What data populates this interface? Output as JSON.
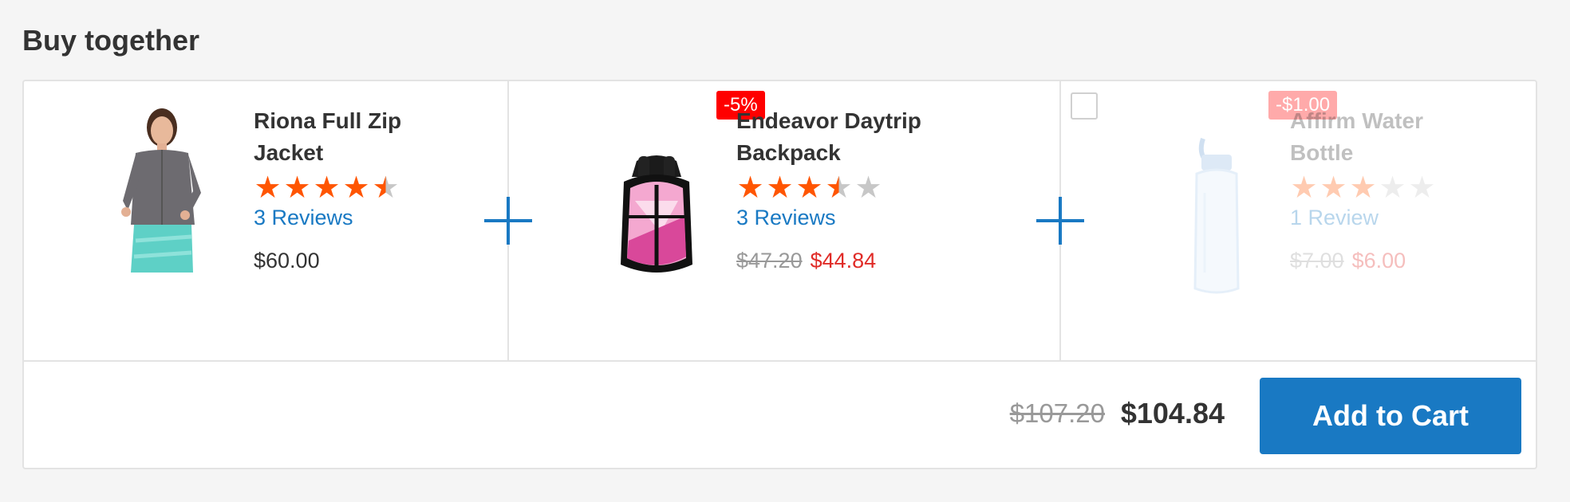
{
  "section_title": "Buy together",
  "products": [
    {
      "name": "Riona Full Zip\nJacket",
      "rating_stars": 4.5,
      "reviews": "3 Reviews",
      "price": "$60.00",
      "image": "jacket-photo"
    },
    {
      "name": "Endeavor Daytrip\nBackpack",
      "rating_stars": 3.5,
      "reviews": "3 Reviews",
      "old_price": "$47.20",
      "price": "$44.84",
      "badge": "-5%",
      "image": "backpack-photo"
    },
    {
      "name": "Affirm Water\nBottle",
      "rating_stars": 3,
      "reviews": "1 Review",
      "old_price": "$7.00",
      "price": "$6.00",
      "badge": "-$1.00",
      "selected": false,
      "image": "water-bottle-photo"
    }
  ],
  "totals": {
    "old_total": "$107.20",
    "total": "$104.84"
  },
  "add_to_cart_label": "Add to Cart",
  "colors": {
    "accent": "#1979c3",
    "star": "#ff5501",
    "sale": "#e02b27",
    "badge": "#ff0000"
  }
}
